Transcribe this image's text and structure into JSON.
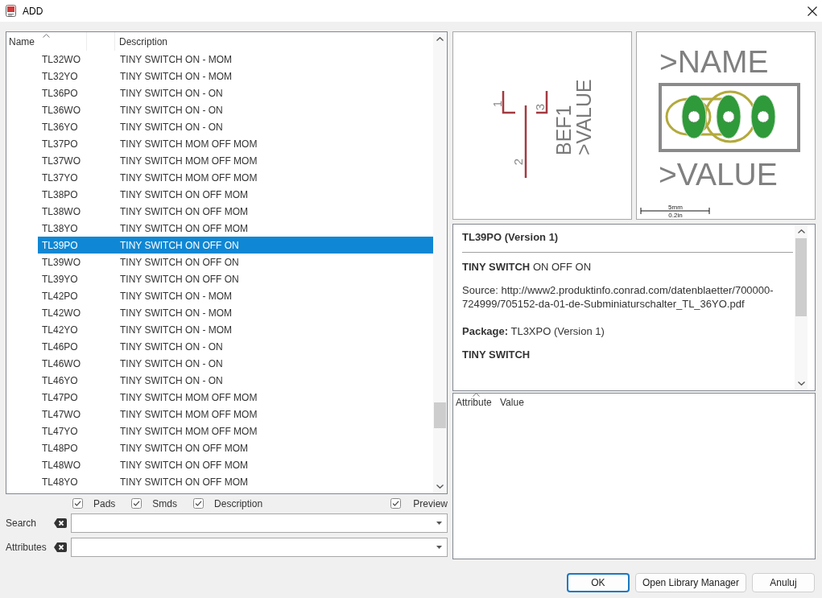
{
  "window": {
    "title": "ADD"
  },
  "library_list": {
    "columns": [
      "Name",
      "Description"
    ],
    "rows": [
      {
        "name": "TL32WO",
        "description": "TINY SWITCH ON - MOM",
        "selected": false
      },
      {
        "name": "TL32YO",
        "description": "TINY SWITCH ON - MOM",
        "selected": false
      },
      {
        "name": "TL36PO",
        "description": "TINY SWITCH ON - ON",
        "selected": false
      },
      {
        "name": "TL36WO",
        "description": "TINY SWITCH ON - ON",
        "selected": false
      },
      {
        "name": "TL36YO",
        "description": "TINY SWITCH ON - ON",
        "selected": false
      },
      {
        "name": "TL37PO",
        "description": "TINY SWITCH MOM OFF MOM",
        "selected": false
      },
      {
        "name": "TL37WO",
        "description": "TINY SWITCH MOM OFF MOM",
        "selected": false
      },
      {
        "name": "TL37YO",
        "description": "TINY SWITCH MOM OFF MOM",
        "selected": false
      },
      {
        "name": "TL38PO",
        "description": "TINY SWITCH ON OFF MOM",
        "selected": false
      },
      {
        "name": "TL38WO",
        "description": "TINY SWITCH ON OFF MOM",
        "selected": false
      },
      {
        "name": "TL38YO",
        "description": "TINY SWITCH ON OFF MOM",
        "selected": false
      },
      {
        "name": "TL39PO",
        "description": "TINY SWITCH ON OFF ON",
        "selected": true
      },
      {
        "name": "TL39WO",
        "description": "TINY SWITCH ON OFF ON",
        "selected": false
      },
      {
        "name": "TL39YO",
        "description": "TINY SWITCH ON OFF ON",
        "selected": false
      },
      {
        "name": "TL42PO",
        "description": "TINY SWITCH ON - MOM",
        "selected": false
      },
      {
        "name": "TL42WO",
        "description": "TINY SWITCH ON - MOM",
        "selected": false
      },
      {
        "name": "TL42YO",
        "description": "TINY SWITCH ON - MOM",
        "selected": false
      },
      {
        "name": "TL46PO",
        "description": "TINY SWITCH ON - ON",
        "selected": false
      },
      {
        "name": "TL46WO",
        "description": "TINY SWITCH ON - ON",
        "selected": false
      },
      {
        "name": "TL46YO",
        "description": "TINY SWITCH ON - ON",
        "selected": false
      },
      {
        "name": "TL47PO",
        "description": "TINY SWITCH MOM OFF MOM",
        "selected": false
      },
      {
        "name": "TL47WO",
        "description": "TINY SWITCH MOM OFF MOM",
        "selected": false
      },
      {
        "name": "TL47YO",
        "description": "TINY SWITCH MOM OFF MOM",
        "selected": false
      },
      {
        "name": "TL48PO",
        "description": "TINY SWITCH ON OFF MOM",
        "selected": false
      },
      {
        "name": "TL48WO",
        "description": "TINY SWITCH ON OFF MOM",
        "selected": false
      },
      {
        "name": "TL48YO",
        "description": "TINY SWITCH ON OFF MOM",
        "selected": false
      }
    ]
  },
  "filters": [
    {
      "label": "Pads",
      "checked": true
    },
    {
      "label": "Smds",
      "checked": true
    },
    {
      "label": "Description",
      "checked": true
    }
  ],
  "preview_toggle": {
    "label": "Preview",
    "checked": true
  },
  "search": {
    "label": "Search"
  },
  "attributes_filter": {
    "label": "Attributes"
  },
  "schematic_preview": {
    "pin_labels": [
      "1",
      "2",
      "3"
    ],
    "name": "BEF1",
    "value": ">VALUE"
  },
  "package_preview": {
    "name": ">NAME",
    "value": ">VALUE",
    "scale_metric": "5mm",
    "scale_imperial": "0.2in"
  },
  "details": {
    "title": "TL39PO (Version 1)",
    "device": "**TINY SWITCH** ON OFF ON",
    "source": "Source: http://www2.produktinfo.conrad.com/datenblaetter/700000-724999/705152-da-01-de-Subminiaturschalter_TL_36YO.pdf",
    "package": "**Package:** TL3XPO (Version 1)",
    "package_description": "TINY SWITCH"
  },
  "attribute_table": {
    "columns": [
      "Attribute",
      "Value"
    ]
  },
  "buttons": [
    {
      "label": "OK",
      "focused": true
    },
    {
      "label": "Open Library Manager",
      "focused": false
    },
    {
      "label": "Anuluj",
      "focused": false
    }
  ]
}
